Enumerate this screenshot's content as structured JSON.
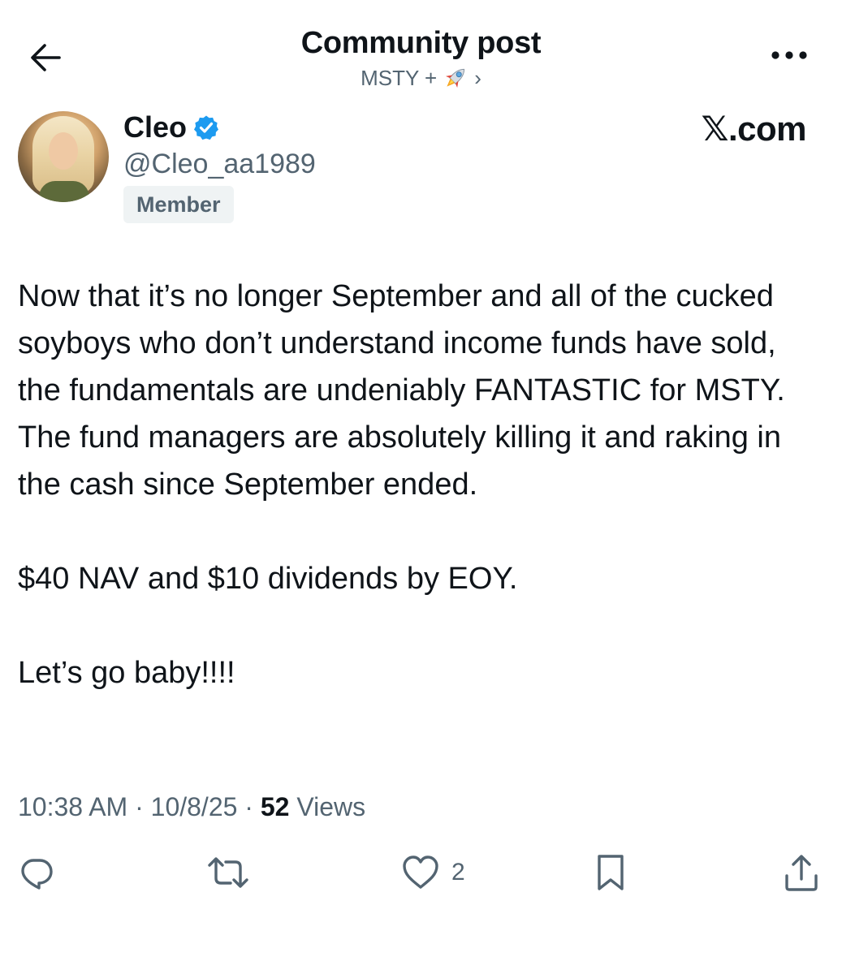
{
  "header": {
    "title": "Community post",
    "community_name": "MSTY +",
    "community_emoji": "🚀",
    "chevron": "›",
    "back_icon": "arrow-left-icon",
    "more_icon": "more-dots-icon"
  },
  "author": {
    "name": "Cleo",
    "handle": "@Cleo_aa1989",
    "verified": true,
    "role_badge": "Member",
    "verified_color": "#1d9bf0"
  },
  "watermark": "𝕏.com",
  "post": {
    "paragraphs": [
      "Now that it’s no longer September and all of the cucked soyboys who don’t understand income funds have sold, the fundamentals are undeniably FANTASTIC for MSTY. The fund managers are absolutely killing it and raking in the cash since September ended.",
      "$40 NAV and $10 dividends by EOY.",
      "Let’s go baby!!!!"
    ]
  },
  "meta": {
    "time": "10:38 AM",
    "separator": "·",
    "date": "10/8/25",
    "views_count": "52",
    "views_label": "Views"
  },
  "actions": {
    "reply_icon": "reply-icon",
    "repost_icon": "repost-icon",
    "like_icon": "heart-icon",
    "like_count": "2",
    "bookmark_icon": "bookmark-icon",
    "share_icon": "share-icon"
  },
  "colors": {
    "text_primary": "#0f1419",
    "text_secondary": "#536471",
    "badge_bg": "#eff3f4",
    "accent": "#1d9bf0"
  }
}
